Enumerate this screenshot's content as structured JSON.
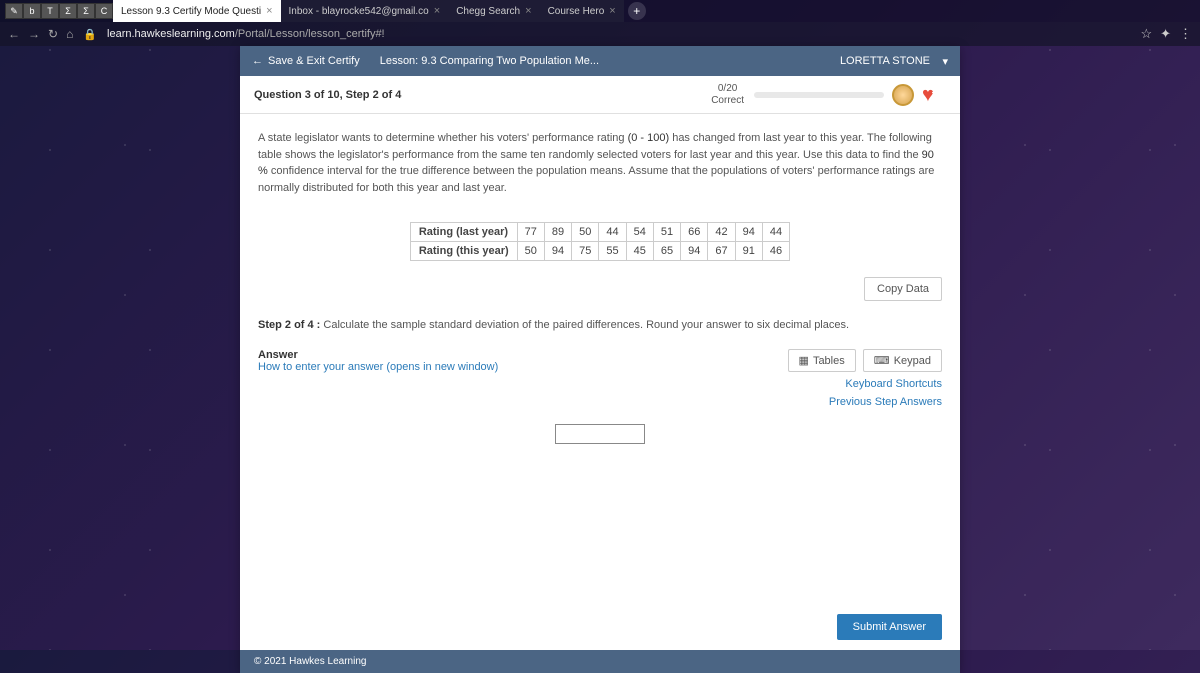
{
  "tabs": {
    "icons": [
      "✎",
      "b",
      "T",
      "Σ",
      "Σ",
      "C"
    ],
    "items": [
      {
        "label": "Lesson 9.3 Certify Mode Questi",
        "active": true
      },
      {
        "label": "Inbox - blayrocke542@gmail.co",
        "active": false
      },
      {
        "label": "Chegg Search",
        "active": false
      },
      {
        "label": "Course Hero",
        "active": false
      }
    ]
  },
  "address": {
    "domain": "learn.hawkeslearning.com",
    "path": "/Portal/Lesson/lesson_certify#!"
  },
  "header": {
    "save_exit": "Save & Exit Certify",
    "lesson": "Lesson: 9.3 Comparing Two Population Me...",
    "user": "LORETTA STONE"
  },
  "qbar": {
    "title": "Question 3 of 10, Step 2 of 4",
    "score": "0/20",
    "correct": "Correct",
    "hearts": "1"
  },
  "question": {
    "text1": "A state legislator wants to determine whether his voters' performance rating ",
    "range": "(0 - 100)",
    "text2": " has changed from last year to this year.  The following table shows the legislator's performance from the same ten randomly selected voters for last year and this year.  Use this data to find the ",
    "conf": "90 %",
    "text3": "  confidence interval for the true difference between the population means.  Assume that the populations of voters' performance ratings are normally distributed for both this year and last year."
  },
  "table": {
    "rows": [
      {
        "label": "Rating (last year)",
        "vals": [
          "77",
          "89",
          "50",
          "44",
          "54",
          "51",
          "66",
          "42",
          "94",
          "44"
        ]
      },
      {
        "label": "Rating (this year)",
        "vals": [
          "50",
          "94",
          "75",
          "55",
          "45",
          "65",
          "94",
          "67",
          "91",
          "46"
        ]
      }
    ]
  },
  "copy_data": "Copy Data",
  "step": {
    "label": "Step 2 of 4 :",
    "text": "  Calculate the sample standard deviation of the paired differences. Round your answer to six decimal places."
  },
  "answer": {
    "label": "Answer",
    "help": "How to enter your answer (opens in new window)",
    "tables_btn": "Tables",
    "keypad_btn": "Keypad",
    "shortcuts": "Keyboard Shortcuts",
    "prev": "Previous Step Answers"
  },
  "submit": "Submit Answer",
  "footer": "© 2021 Hawkes Learning"
}
